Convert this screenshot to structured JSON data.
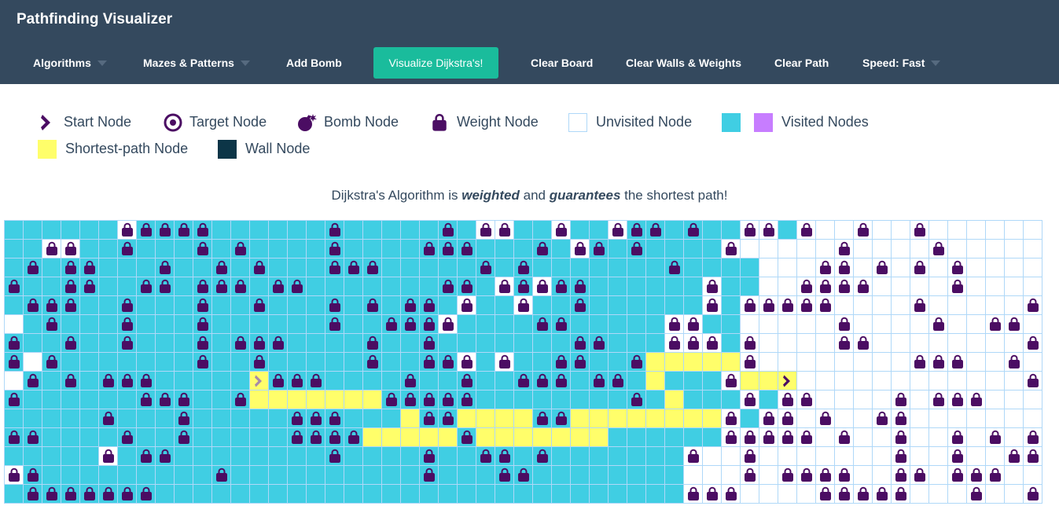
{
  "navbar": {
    "title": "Pathfinding Visualizer",
    "algorithms": "Algorithms",
    "mazes": "Mazes & Patterns",
    "add_bomb": "Add Bomb",
    "visualize": "Visualize Dijkstra's!",
    "clear_board": "Clear Board",
    "clear_walls": "Clear Walls & Weights",
    "clear_path": "Clear Path",
    "speed": "Speed: Fast"
  },
  "legend": {
    "start": "Start Node",
    "target": "Target Node",
    "bomb": "Bomb Node",
    "weight": "Weight Node",
    "unvisited": "Unvisited Node",
    "visited": "Visited Nodes",
    "shortest": "Shortest-path Node",
    "wall": "Wall Node"
  },
  "caption": {
    "pre": "Dijkstra's Algorithm is ",
    "em1": "weighted",
    "mid": " and ",
    "em2": "guarantees",
    "post": " the shortest path!"
  },
  "colors": {
    "navbar": "#34495e",
    "visualize_button": "#1abc9c",
    "visited": "#40cee3",
    "visited_alt": "#c77dff",
    "shortest_path": "#fffe6a",
    "wall": "#0c3547",
    "weight_icon": "#4b0d63",
    "grid_line": "#afd8f8"
  },
  "grid": {
    "legend_codes": {
      "v": "visited",
      "u": "unvisited",
      "p": "shortest-path",
      "s": "start",
      "t": "target",
      "W": "weight on visited",
      "w": "weight on unvisited"
    },
    "rows": [
      "vvvvvvwWWWWvvvvvvWvvvvvWvwwvvwvvwWWvWvvwwvwuuwuuwuuuuuu",
      "vvwwvvWvvvWvWvvvvWvvvvWWWvvvWvwWvWvvvvwuuuuuwuuuuwuuuuu",
      "vWvWWvvvWvvWvWvvvWWWvvvvvWvWvvvvvvvWvvvvuuuwwuwuwuwuuuu",
      "WvvWWvvWWvWWWvWWvvvvvvvWWvwWwWWvvvvvvwvvuuwwwwuuuuwuuuu",
      "vWWWvvWvvvWvvWvvvWvWvWWvwvvwvvWvvvvvvwvwwwwwuuuuwuuuuuw",
      "uvWvvvWvvvWvvvvvvWvvWWWwvvvvWWvvvvvwwvvuuuuuwuuuuwuuwwu",
      "WvvWvvWvvvWvWWWvvvvWvvWvvvvvvvWWvvvwwwvwuuuuwwuuuuuuuuw",
      "WuWvvvvvvvWvvWvvvvvWvvWWwvwvvWWvvWpppppwuuuuuuuuwwwuuwu",
      "uWvWvWWWvvvvvsWWWvvvvWvvWvvWWWvWWvpvvvwpptuuuuuuuuuuuuw",
      "WvvvvvvWWWvvWpppppppWWWWWvvvvvvvvWvpvvvwvwwuuuuwuwwwuuu",
      "vvvvvWvvvWvvvvvWWWvvvpWWppppWWppppppppwvwwuwuuwwuuuuuuu",
      "WWvvvvWvvWvvvvvWWWWpppppWpppppppvvvvvvwwwwwuwuuwuuwuwuw",
      "vvvvvwvWWvvvvvvvvWvvvvWvvWWvWvvvvvvvwuuwuuuuuuuwuuwuuww",
      "wWvvvvvvvvvWvvvvvvvvvvWvvvWWvvvvvvvvuuuwuwwwwuuwwuwwwuu",
      "vWWWWWWWvvvvvvvvvvvvvvvvvvvvvvvvvvvvwwwuuuuwwwwwuuuwuuw"
    ]
  }
}
